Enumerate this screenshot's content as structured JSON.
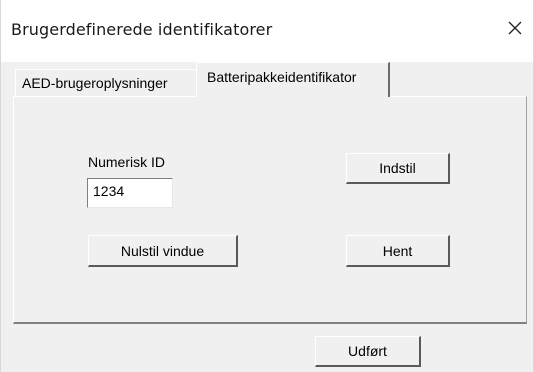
{
  "window": {
    "title": "Brugerdefinerede identifikatorer"
  },
  "tabs": [
    {
      "label": "AED-brugeroplysninger",
      "active": false
    },
    {
      "label": "Batteripakkeidentifikator",
      "active": true
    }
  ],
  "form": {
    "numeric_id_label": "Numerisk ID",
    "numeric_id_value": "1234",
    "set_button": "Indstil",
    "reset_button": "Nulstil vindue",
    "get_button": "Hent"
  },
  "footer": {
    "done_button": "Udført"
  },
  "icons": {
    "close": "close-icon"
  }
}
